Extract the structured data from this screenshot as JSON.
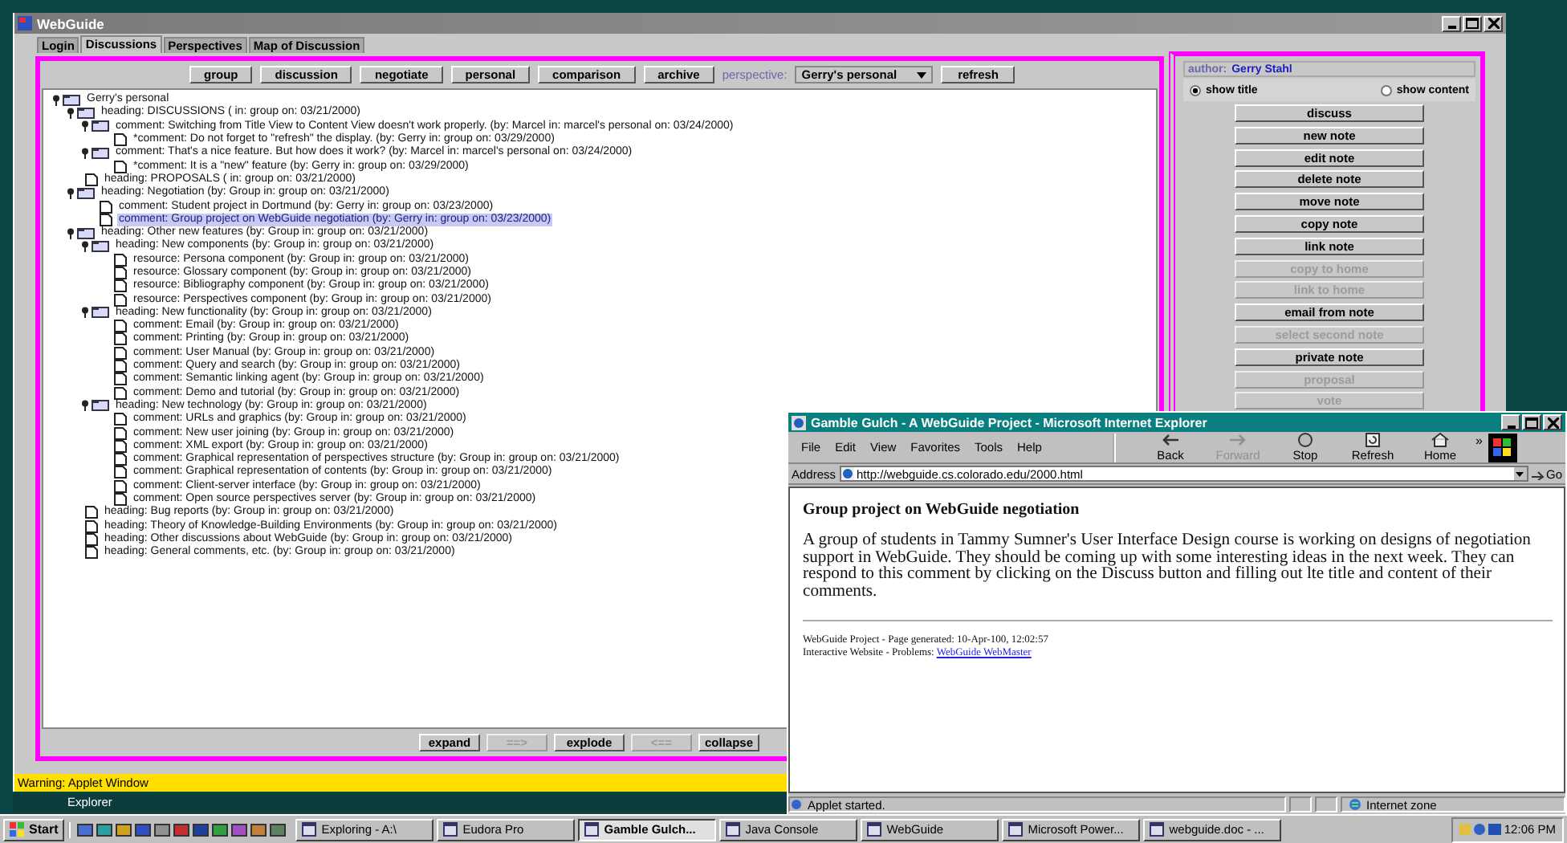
{
  "webguide": {
    "title": "WebGuide",
    "tabs": [
      {
        "label": "Login",
        "selected": false
      },
      {
        "label": "Discussions",
        "selected": true
      },
      {
        "label": "Perspectives",
        "selected": false
      },
      {
        "label": "Map of Discussion",
        "selected": false
      }
    ],
    "toolbar": {
      "buttons": [
        "group",
        "discussion",
        "negotiate",
        "personal",
        "comparison",
        "archive"
      ],
      "perspective_label": "perspective:",
      "perspective_value": "Gerry's personal",
      "refresh": "refresh"
    },
    "tree": {
      "text": "Gerry's personal",
      "kind": "folder",
      "expanded": true,
      "selected": false,
      "children": [
        {
          "text": "heading:  DISCUSSIONS  ( in: group on: 03/21/2000)",
          "kind": "folder",
          "expanded": true,
          "selected": false,
          "children": [
            {
              "text": "comment:  Switching from Title View to Content View doesn't work properly.  (by: Marcel in: marcel's personal on: 03/24/2000)",
              "kind": "folder",
              "expanded": true,
              "selected": false,
              "children": [
                {
                  "text": "*comment:  Do not forget to \"refresh\" the display.  (by: Gerry in: group on: 03/29/2000)",
                  "kind": "note",
                  "selected": false
                }
              ]
            },
            {
              "text": "comment:  That's a nice feature. But how does it work?  (by: Marcel in: marcel's personal on: 03/24/2000)",
              "kind": "folder",
              "expanded": true,
              "selected": false,
              "children": [
                {
                  "text": "*comment:  It is a \"new\" feature  (by: Gerry in: group on: 03/29/2000)",
                  "kind": "note",
                  "selected": false
                }
              ]
            }
          ]
        },
        {
          "text": "heading:  PROPOSALS  ( in: group on: 03/21/2000)",
          "kind": "note",
          "selected": false
        },
        {
          "text": "heading:  Negotiation  (by: Group in: group on: 03/21/2000)",
          "kind": "folder",
          "expanded": true,
          "selected": false,
          "children": [
            {
              "text": "comment:  Student project in Dortmund  (by: Gerry in: group on: 03/23/2000)",
              "kind": "note",
              "selected": false
            },
            {
              "text": "comment:  Group project on WebGuide negotiation  (by: Gerry in: group on: 03/23/2000)",
              "kind": "note",
              "selected": true
            }
          ]
        },
        {
          "text": "heading:  Other new features  (by: Group in: group on: 03/21/2000)",
          "kind": "folder",
          "expanded": true,
          "selected": false,
          "children": [
            {
              "text": "heading:  New components  (by: Group in: group on: 03/21/2000)",
              "kind": "folder",
              "expanded": true,
              "selected": false,
              "children": [
                {
                  "text": "resource:  Persona component  (by: Group in: group on: 03/21/2000)",
                  "kind": "note",
                  "selected": false
                },
                {
                  "text": "resource:  Glossary component  (by: Group in: group on: 03/21/2000)",
                  "kind": "note",
                  "selected": false
                },
                {
                  "text": "resource:  Bibliography component  (by: Group in: group on: 03/21/2000)",
                  "kind": "note",
                  "selected": false
                },
                {
                  "text": "resource:  Perspectives component  (by: Group in: group on: 03/21/2000)",
                  "kind": "note",
                  "selected": false
                }
              ]
            },
            {
              "text": "heading:  New functionality  (by: Group in: group on: 03/21/2000)",
              "kind": "folder",
              "expanded": true,
              "selected": false,
              "children": [
                {
                  "text": "comment:  Email  (by: Group in: group on: 03/21/2000)",
                  "kind": "note",
                  "selected": false
                },
                {
                  "text": "comment:  Printing  (by: Group in: group on: 03/21/2000)",
                  "kind": "note",
                  "selected": false
                },
                {
                  "text": "comment:  User Manual  (by: Group in: group on: 03/21/2000)",
                  "kind": "note",
                  "selected": false
                },
                {
                  "text": "comment:  Query and search  (by: Group in: group on: 03/21/2000)",
                  "kind": "note",
                  "selected": false
                },
                {
                  "text": "comment:  Semantic linking agent  (by: Group in: group on: 03/21/2000)",
                  "kind": "note",
                  "selected": false
                },
                {
                  "text": "comment:  Demo and tutorial  (by: Group in: group on: 03/21/2000)",
                  "kind": "note",
                  "selected": false
                }
              ]
            },
            {
              "text": "heading:  New technology  (by: Group in: group on: 03/21/2000)",
              "kind": "folder",
              "expanded": true,
              "selected": false,
              "children": [
                {
                  "text": "comment:  URLs and graphics  (by: Group in: group on: 03/21/2000)",
                  "kind": "note",
                  "selected": false
                },
                {
                  "text": "comment:  New user joining  (by: Group in: group on: 03/21/2000)",
                  "kind": "note",
                  "selected": false
                },
                {
                  "text": "comment:  XML export  (by: Group in: group on: 03/21/2000)",
                  "kind": "note",
                  "selected": false
                },
                {
                  "text": "comment:  Graphical representation of perspectives structure  (by: Group in: group on: 03/21/2000)",
                  "kind": "note",
                  "selected": false
                },
                {
                  "text": "comment:  Graphical representation of contents  (by: Group in: group on: 03/21/2000)",
                  "kind": "note",
                  "selected": false
                },
                {
                  "text": "comment:  Client-server interface  (by: Group in: group on: 03/21/2000)",
                  "kind": "note",
                  "selected": false
                },
                {
                  "text": "comment:  Open source perspectives server  (by: Group in: group on: 03/21/2000)",
                  "kind": "note",
                  "selected": false
                }
              ]
            }
          ]
        },
        {
          "text": "heading:  Bug reports  (by: Group in: group on: 03/21/2000)",
          "kind": "note",
          "selected": false
        },
        {
          "text": "heading:  Theory of Knowledge-Building Environments  (by: Group in: group on: 03/21/2000)",
          "kind": "note",
          "selected": false
        },
        {
          "text": "heading:  Other discussions about WebGuide  (by: Group in: group on: 03/21/2000)",
          "kind": "note",
          "selected": false
        },
        {
          "text": "heading:  General comments, etc.  (by: Group in: group on: 03/21/2000)",
          "kind": "note",
          "selected": false
        }
      ]
    },
    "tree_buttons": [
      {
        "label": "expand",
        "disabled": false
      },
      {
        "label": "==>",
        "disabled": true
      },
      {
        "label": "explode",
        "disabled": false
      },
      {
        "label": "<==",
        "disabled": true
      },
      {
        "label": "collapse",
        "disabled": false
      }
    ],
    "side_panel": {
      "author_label": "author:",
      "author": "Gerry Stahl",
      "view_options": [
        {
          "label": "show title",
          "selected": true
        },
        {
          "label": "show content",
          "selected": false
        }
      ],
      "buttons": [
        {
          "label": "discuss",
          "disabled": false
        },
        {
          "label": "new note",
          "disabled": false
        },
        {
          "label": "edit note",
          "disabled": false
        },
        {
          "label": "delete note",
          "disabled": false
        },
        {
          "label": "move note",
          "disabled": false
        },
        {
          "label": "copy note",
          "disabled": false
        },
        {
          "label": "link note",
          "disabled": false
        },
        {
          "label": "copy to home",
          "disabled": true
        },
        {
          "label": "link to home",
          "disabled": true
        },
        {
          "label": "email from note",
          "disabled": false
        },
        {
          "label": "select second note",
          "disabled": true
        },
        {
          "label": "private note",
          "disabled": false
        },
        {
          "label": "proposal",
          "disabled": true
        },
        {
          "label": "vote",
          "disabled": true
        }
      ]
    },
    "warning": "Warning: Applet Window"
  },
  "background_window": {
    "title": "Explorer"
  },
  "browser": {
    "title": "Gamble Gulch - A WebGuide Project - Microsoft Internet Explorer",
    "menus": [
      "File",
      "Edit",
      "View",
      "Favorites",
      "Tools",
      "Help"
    ],
    "nav_buttons": [
      {
        "label": "Back",
        "disabled": false
      },
      {
        "label": "Forward",
        "disabled": true
      },
      {
        "label": "Stop",
        "disabled": false
      },
      {
        "label": "Refresh",
        "disabled": false
      },
      {
        "label": "Home",
        "disabled": false
      }
    ],
    "more": "»",
    "address_label": "Address",
    "url": "http://webguide.cs.colorado.edu/2000.html",
    "go": "Go",
    "page": {
      "heading": "Group project on WebGuide negotiation",
      "body": "A group of students in Tammy Sumner's User Interface Design course is working on designs of negotiation support in WebGuide. They should be coming up with some interesting ideas in the next week. They can respond to this comment by clicking on the Discuss button and filling out lte title and content of their comments.",
      "footer_1": "WebGuide Project - Page generated: 10-Apr-100, 12:02:57",
      "footer_2": "Interactive Website - Problems: ",
      "footer_link": "WebGuide WebMaster"
    },
    "status": "Applet started.",
    "zone": "Internet zone"
  },
  "taskbar": {
    "start": "Start",
    "tasks": [
      {
        "label": "Exploring - A:\\",
        "selected": false
      },
      {
        "label": "Eudora Pro",
        "selected": false
      },
      {
        "label": "Gamble Gulch...",
        "selected": true
      },
      {
        "label": "Java Console",
        "selected": false
      },
      {
        "label": "WebGuide",
        "selected": false
      },
      {
        "label": "Microsoft Power...",
        "selected": false
      },
      {
        "label": "webguide.doc - ...",
        "selected": false
      }
    ],
    "clock": "12:06 PM"
  }
}
